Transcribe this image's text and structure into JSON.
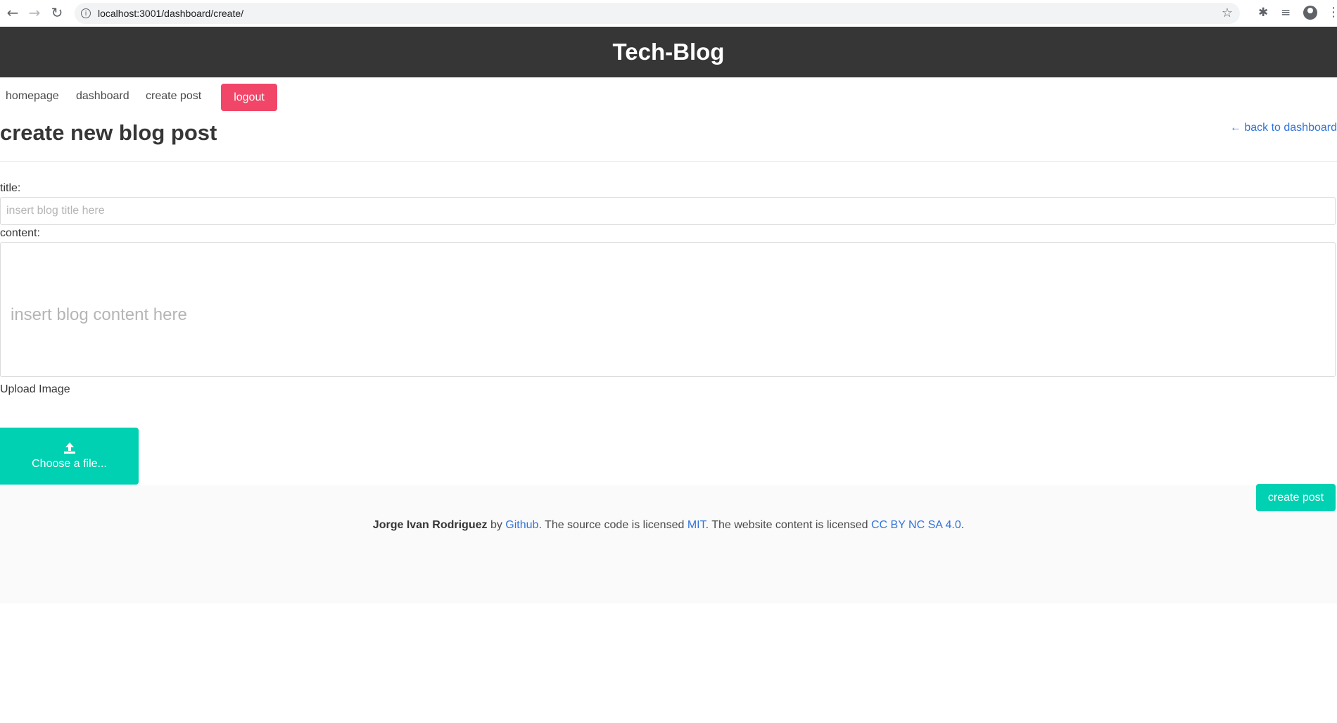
{
  "browser": {
    "url": "localhost:3001/dashboard/create/"
  },
  "header": {
    "title": "Tech-Blog"
  },
  "nav": {
    "homepage": "homepage",
    "dashboard": "dashboard",
    "create_post": "create post",
    "logout": "logout"
  },
  "page": {
    "title": "create new blog post",
    "back_link": "← back to dashboard"
  },
  "form": {
    "title_label": "title:",
    "title_placeholder": "insert blog title here",
    "title_value": "",
    "content_label": "content:",
    "content_placeholder": "insert blog content here",
    "content_value": "",
    "upload_label": "Upload Image",
    "choose_file": "Choose a file...",
    "submit": "create post"
  },
  "footer": {
    "author": "Jorge Ivan Rodriguez",
    "by": " by ",
    "github": "Github",
    "source_text": ". The source code is licensed ",
    "mit": "MIT",
    "content_text": ". The website content is licensed ",
    "cc": "CC BY NC SA 4.0",
    "end": "."
  },
  "colors": {
    "header_bg": "#363636",
    "danger": "#f14668",
    "primary": "#00d1b2",
    "link": "#3273dc",
    "footer_bg": "#fafafa"
  },
  "icons": [
    "back-arrow-icon",
    "forward-arrow-icon",
    "reload-icon",
    "site-info-icon",
    "bookmark-star-icon",
    "extensions-icon",
    "media-icon",
    "profile-icon",
    "menu-icon",
    "upload-icon"
  ]
}
